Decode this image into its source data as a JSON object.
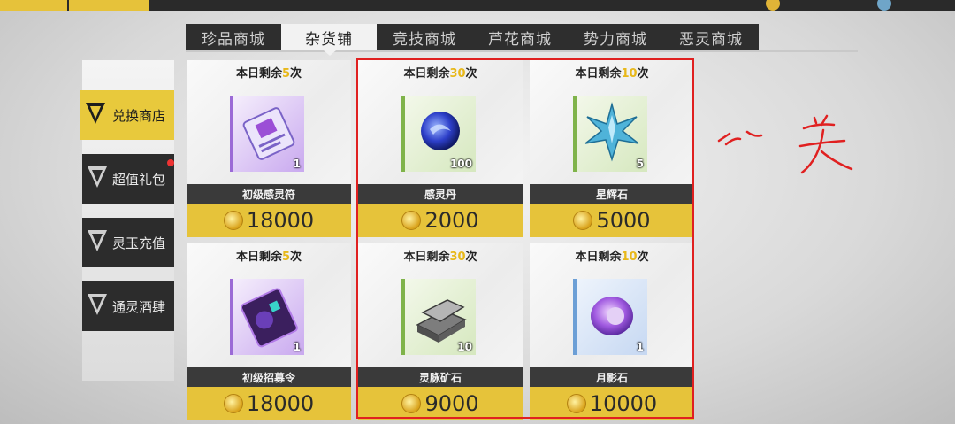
{
  "tabs": [
    "珍品商城",
    "杂货铺",
    "竞技商城",
    "芦花商城",
    "势力商城",
    "恶灵商城"
  ],
  "active_tab": 1,
  "sidebar": {
    "items": [
      {
        "label": "兑换商店",
        "active": true,
        "badge": false
      },
      {
        "label": "超值礼包",
        "active": false,
        "badge": true
      },
      {
        "label": "灵玉充值",
        "active": false,
        "badge": false
      },
      {
        "label": "通灵酒肆",
        "active": false,
        "badge": false
      }
    ]
  },
  "products": [
    {
      "limit_prefix": "本日剩余",
      "limit_num": "5",
      "limit_suffix": "次",
      "name": "初级感灵符",
      "count": "1",
      "price": "18000",
      "icon": "ticket-icon",
      "frame_color": "#9b6ad6"
    },
    {
      "limit_prefix": "本日剩余",
      "limit_num": "30",
      "limit_suffix": "次",
      "name": "感灵丹",
      "count": "100",
      "price": "2000",
      "icon": "orb-icon",
      "frame_color": "#7fb34a"
    },
    {
      "limit_prefix": "本日剩余",
      "limit_num": "10",
      "limit_suffix": "次",
      "name": "星辉石",
      "count": "5",
      "price": "5000",
      "icon": "star-crystal-icon",
      "frame_color": "#7fb34a"
    },
    {
      "limit_prefix": "本日剩余",
      "limit_num": "5",
      "limit_suffix": "次",
      "name": "初级招募令",
      "count": "1",
      "price": "18000",
      "icon": "card-icon",
      "frame_color": "#9b6ad6"
    },
    {
      "limit_prefix": "本日剩余",
      "limit_num": "30",
      "limit_suffix": "次",
      "name": "灵脉矿石",
      "count": "10",
      "price": "9000",
      "icon": "ore-icon",
      "frame_color": "#7fb34a"
    },
    {
      "limit_prefix": "本日剩余",
      "limit_num": "10",
      "limit_suffix": "次",
      "name": "月影石",
      "count": "1",
      "price": "10000",
      "icon": "moon-stone-icon",
      "frame_color": "#6c9fd6"
    }
  ],
  "annotation_color": "#e02020"
}
